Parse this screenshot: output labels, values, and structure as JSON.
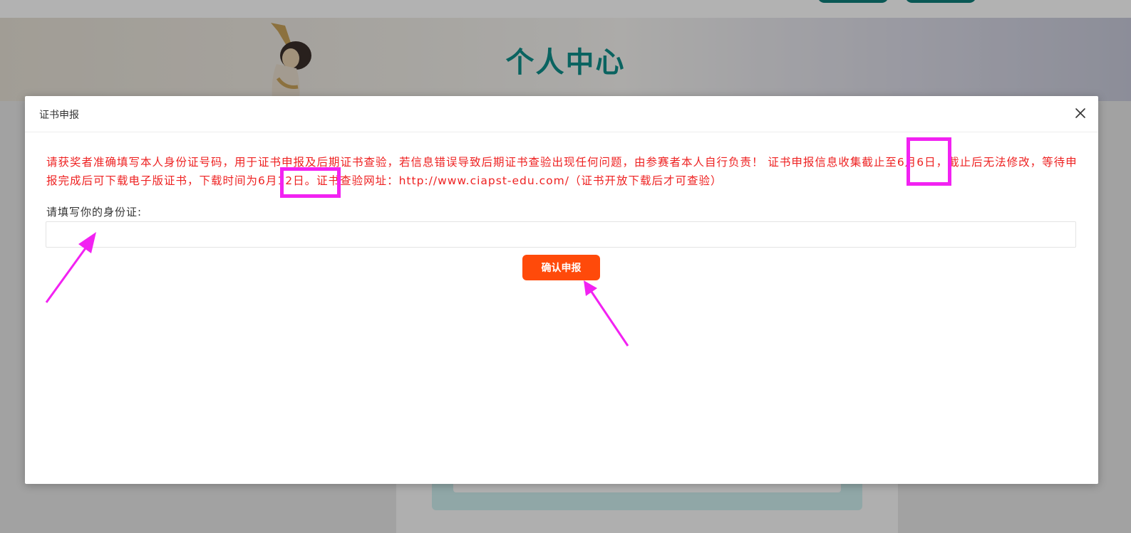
{
  "banner": {
    "title": "个人中心"
  },
  "modal": {
    "title": "证书申报",
    "notice": "请获奖者准确填写本人身份证号码，用于证书申报及后期证书查验，若信息错误导致后期证书查验出现任何问题，由参赛者本人自行负责！ 证书申报信息收集截止至6月6日，截止后无法修改，等待申报完成后可下载电子版证书，下载时间为6月12日。证书查验网址：http://www.ciapst-edu.com/（证书开放下载后才可查验）",
    "id_label": "请填写你的身份证:",
    "id_value": "",
    "id_placeholder": "",
    "confirm_label": "确认申报"
  },
  "icons": {
    "close": "close-icon"
  },
  "colors": {
    "notice_text": "#ee2222",
    "confirm_button": "#ff4a0a",
    "banner_title": "#0f8f8a",
    "annotation": "#f222f2"
  }
}
